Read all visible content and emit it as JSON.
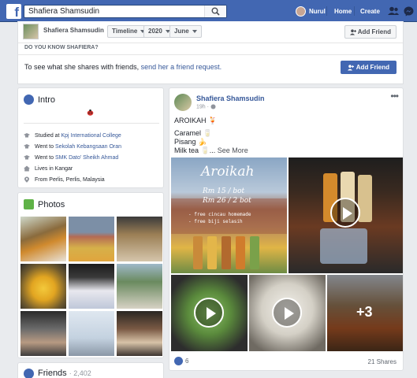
{
  "topbar": {
    "search_value": "Shafiera Shamsudin",
    "user_name": "Nurul",
    "home_label": "Home",
    "create_label": "Create",
    "colors": {
      "bar": "#4267b2"
    }
  },
  "profile": {
    "name": "Shafiera Shamsudin",
    "timeline_label": "Timeline",
    "year": "2020",
    "month": "June",
    "add_friend_label": "Add Friend",
    "know_label": "DO YOU KNOW SHAFIERA?",
    "message_prefix": "To see what she shares with friends,",
    "message_link": "send her a friend request.",
    "add_friend_blue_label": "Add Friend"
  },
  "intro": {
    "title": "Intro",
    "bio_icon": "ladybug-emoji",
    "items": [
      {
        "icon": "education-icon",
        "prefix": "Studied at",
        "link": "Kpj International College"
      },
      {
        "icon": "education-icon",
        "prefix": "Went to",
        "link": "Sekolah Kebangsaan Oran"
      },
      {
        "icon": "education-icon",
        "prefix": "Went to",
        "link": "SMK Dato' Sheikh Ahmad"
      },
      {
        "icon": "home-icon",
        "prefix": "Lives in Kangar",
        "link": ""
      },
      {
        "icon": "location-pin-icon",
        "prefix": "From Perlis, Perlis, Malaysia",
        "link": ""
      }
    ]
  },
  "photos": {
    "title": "Photos"
  },
  "friends": {
    "title": "Friends",
    "count": "· 2,402"
  },
  "post": {
    "author": "Shafiera Shamsudin",
    "time": "19h · ",
    "line1": "AROIKAH 🍹",
    "line2": "Caramel 🥛",
    "line3": "Pisang 🍌",
    "line4": "Milk tea 🥛... ",
    "see_more": "See More",
    "image_title": "Aroikah",
    "image_price1": "Rm 15 / bot",
    "image_price2": "Rm 26 / 2 bot",
    "image_note1": "- free cincau homemade",
    "image_note2": "- free biji selasih",
    "more_photos": "+3",
    "likes": "6",
    "shares": "21 Shares"
  }
}
